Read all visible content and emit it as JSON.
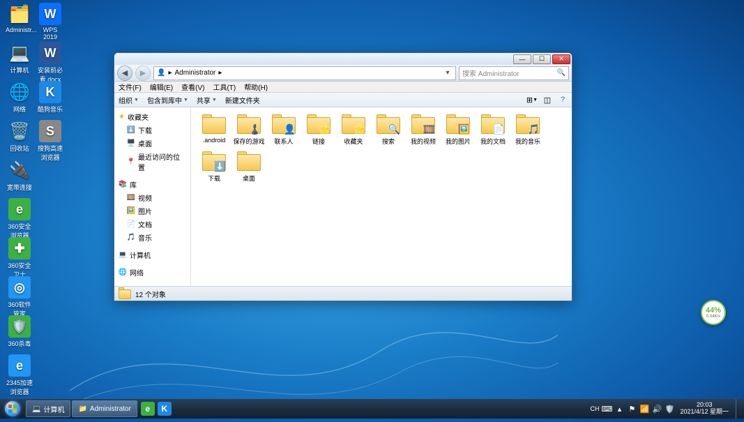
{
  "desktop_icons_col1": [
    {
      "label": "Administr...",
      "glyph": "🗂️",
      "bg": ""
    },
    {
      "label": "计算机",
      "glyph": "💻",
      "bg": ""
    },
    {
      "label": "网络",
      "glyph": "🌐",
      "bg": ""
    },
    {
      "label": "回收站",
      "glyph": "🗑️",
      "bg": ""
    },
    {
      "label": "宽带连接",
      "glyph": "🔌",
      "bg": ""
    },
    {
      "label": "360安全浏览器",
      "glyph": "e",
      "bg": "#3cb043"
    },
    {
      "label": "360安全卫士",
      "glyph": "✚",
      "bg": "#3cb043"
    },
    {
      "label": "360软件管家",
      "glyph": "◎",
      "bg": "#2196f3"
    },
    {
      "label": "360杀毒",
      "glyph": "🛡️",
      "bg": "#3cb043"
    },
    {
      "label": "2345加速浏览器",
      "glyph": "e",
      "bg": "#2196f3"
    }
  ],
  "desktop_icons_col2": [
    {
      "label": "WPS 2019",
      "glyph": "W",
      "bg": "#0d6efd"
    },
    {
      "label": "安装前必看.docx",
      "glyph": "W",
      "bg": "#2b579a"
    },
    {
      "label": "酷狗音乐",
      "glyph": "K",
      "bg": "#1e88e5"
    },
    {
      "label": "搜狗高速浏览器",
      "glyph": "S",
      "bg": "#888"
    }
  ],
  "window": {
    "breadcrumb": {
      "root_icon": "👤",
      "current": "Administrator",
      "sep": "▸"
    },
    "search_placeholder": "搜索 Administrator",
    "menubar": [
      "文件(F)",
      "编辑(E)",
      "查看(V)",
      "工具(T)",
      "帮助(H)"
    ],
    "toolbar": {
      "organize": "组织",
      "include": "包含到库中",
      "share": "共享",
      "newfolder": "新建文件夹"
    },
    "win_min": "—",
    "win_max": "☐",
    "win_close": "✕",
    "sidebar": {
      "favorites": {
        "head": "收藏夹",
        "items": [
          {
            "ic": "⬇️",
            "label": "下载"
          },
          {
            "ic": "🖥️",
            "label": "桌面"
          },
          {
            "ic": "📍",
            "label": "最近访问的位置"
          }
        ]
      },
      "libraries": {
        "head": "库",
        "items": [
          {
            "ic": "🎞️",
            "label": "视频"
          },
          {
            "ic": "🖼️",
            "label": "图片"
          },
          {
            "ic": "📄",
            "label": "文档"
          },
          {
            "ic": "🎵",
            "label": "音乐"
          }
        ]
      },
      "computer": {
        "head": "计算机"
      },
      "network": {
        "head": "网络"
      }
    },
    "folders": [
      {
        "label": ".android",
        "ov": ""
      },
      {
        "label": "保存的游戏",
        "ov": "♟️"
      },
      {
        "label": "联系人",
        "ov": "👤"
      },
      {
        "label": "链接",
        "ov": "⭐"
      },
      {
        "label": "收藏夹",
        "ov": "⭐"
      },
      {
        "label": "搜索",
        "ov": "🔍"
      },
      {
        "label": "我的视频",
        "ov": "🎞️"
      },
      {
        "label": "我的图片",
        "ov": "🖼️"
      },
      {
        "label": "我的文档",
        "ov": "📄"
      },
      {
        "label": "我的音乐",
        "ov": "🎵"
      },
      {
        "label": "下载",
        "ov": "⬇️"
      },
      {
        "label": "桌面",
        "ov": ""
      }
    ],
    "status": "12 个对象"
  },
  "taskbar": {
    "buttons": [
      {
        "ic": "💻",
        "label": "计算机"
      },
      {
        "ic": "📁",
        "label": "Administrator"
      }
    ],
    "pinned": [
      {
        "glyph": "e",
        "bg": "#3cb043"
      },
      {
        "glyph": "K",
        "bg": "#1e88e5"
      }
    ],
    "tray_lang": "CH",
    "time": "20:03",
    "date": "2021/4/12 星期一"
  },
  "gadget": {
    "pct": "44%",
    "sub": "0.04K/s"
  }
}
